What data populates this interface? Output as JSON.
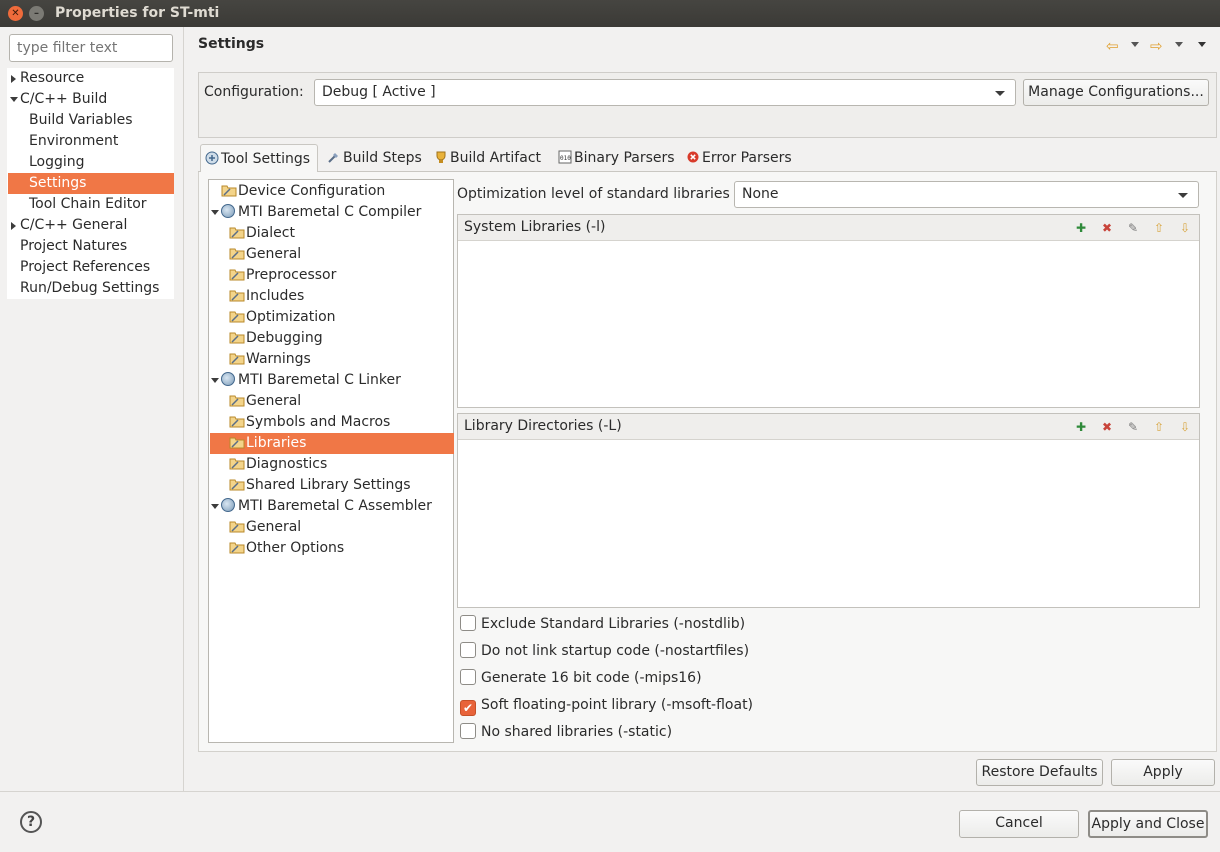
{
  "window": {
    "title": "Properties for ST-mti"
  },
  "filter": {
    "placeholder": "type filter text"
  },
  "nav": {
    "items": [
      {
        "label": "Resource"
      },
      {
        "label": "C/C++ Build"
      },
      {
        "label": "Build Variables"
      },
      {
        "label": "Environment"
      },
      {
        "label": "Logging"
      },
      {
        "label": "Settings"
      },
      {
        "label": "Tool Chain Editor"
      },
      {
        "label": "C/C++ General"
      },
      {
        "label": "Project Natures"
      },
      {
        "label": "Project References"
      },
      {
        "label": "Run/Debug Settings"
      }
    ],
    "selected": "Settings"
  },
  "header": {
    "title": "Settings"
  },
  "configuration": {
    "label": "Configuration:",
    "value": "Debug  [ Active ]",
    "manage_label": "Manage Configurations..."
  },
  "tabs": [
    {
      "label": "Tool Settings",
      "icon": "tool-settings-icon"
    },
    {
      "label": "Build Steps",
      "icon": "build-steps-icon"
    },
    {
      "label": "Build Artifact",
      "icon": "build-artifact-icon"
    },
    {
      "label": "Binary Parsers",
      "icon": "binary-parsers-icon"
    },
    {
      "label": "Error Parsers",
      "icon": "error-parsers-icon"
    }
  ],
  "tooltree": {
    "items": [
      {
        "label": "Device Configuration"
      },
      {
        "label": "MTI Baremetal C Compiler"
      },
      {
        "label": "Dialect"
      },
      {
        "label": "General"
      },
      {
        "label": "Preprocessor"
      },
      {
        "label": "Includes"
      },
      {
        "label": "Optimization"
      },
      {
        "label": "Debugging"
      },
      {
        "label": "Warnings"
      },
      {
        "label": "MTI Baremetal C Linker"
      },
      {
        "label": "General"
      },
      {
        "label": "Symbols and Macros"
      },
      {
        "label": "Libraries"
      },
      {
        "label": "Diagnostics"
      },
      {
        "label": "Shared Library Settings"
      },
      {
        "label": "MTI Baremetal C Assembler"
      },
      {
        "label": "General"
      },
      {
        "label": "Other Options"
      }
    ],
    "selected": "Libraries"
  },
  "libraries": {
    "opt_label": "Optimization level of standard libraries",
    "opt_value": "None",
    "system_libraries": {
      "title": "System Libraries (-l)",
      "items": []
    },
    "library_directories": {
      "title": "Library Directories (-L)",
      "items": []
    },
    "options": [
      {
        "label": "Exclude Standard Libraries (-nostdlib)",
        "checked": false
      },
      {
        "label": "Do not link startup code (-nostartfiles)",
        "checked": false
      },
      {
        "label": "Generate 16 bit code (-mips16)",
        "checked": false
      },
      {
        "label": "Soft floating-point library (-msoft-float)",
        "checked": true
      },
      {
        "label": "No shared libraries (-static)",
        "checked": false
      }
    ]
  },
  "buttons": {
    "restore": "Restore Defaults",
    "apply": "Apply",
    "cancel": "Cancel",
    "apply_close": "Apply and Close",
    "help": "?"
  },
  "colors": {
    "selection": "#f07746",
    "titlebar": "#3f3e3a",
    "checkbox_on": "#e8633a"
  }
}
